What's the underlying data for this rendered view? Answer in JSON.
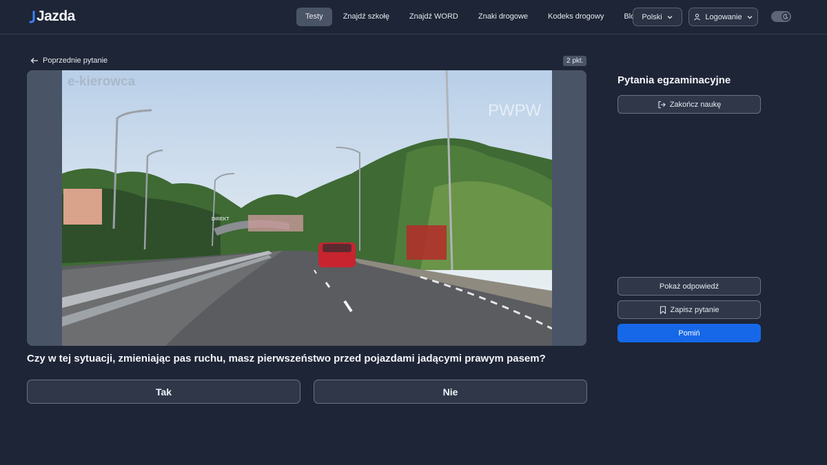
{
  "header": {
    "logo": "Jazda",
    "nav": [
      {
        "label": "Testy",
        "active": true
      },
      {
        "label": "Znajdź szkołę",
        "active": false
      },
      {
        "label": "Znajdź WORD",
        "active": false
      },
      {
        "label": "Znaki drogowe",
        "active": false
      },
      {
        "label": "Kodeks drogowy",
        "active": false
      },
      {
        "label": "Blog",
        "active": false
      }
    ],
    "language": "Polski",
    "login": "Logowanie",
    "theme_toggle_icon": "moon-icon"
  },
  "main": {
    "back_link": "Poprzednie pytanie",
    "points": "2 pkt.",
    "media": {
      "watermark_left": "e-kierowca",
      "watermark_right": "PWPW",
      "sign_text": "DIREKT"
    },
    "question": "Czy w tej sytuacji, zmieniając pas ruchu, masz pierwszeństwo przed pojazdami jadącymi prawym pasem?",
    "answers": {
      "yes": "Tak",
      "no": "Nie"
    }
  },
  "sidebar": {
    "title": "Pytania egzaminacyjne",
    "finish": "Zakończ naukę",
    "show_answer": "Pokaż odpowiedź",
    "save_question": "Zapisz pytanie",
    "skip": "Pomiń"
  },
  "colors": {
    "background": "#1e2536",
    "accent": "#1668e8",
    "nav_active": "#4a5467"
  }
}
